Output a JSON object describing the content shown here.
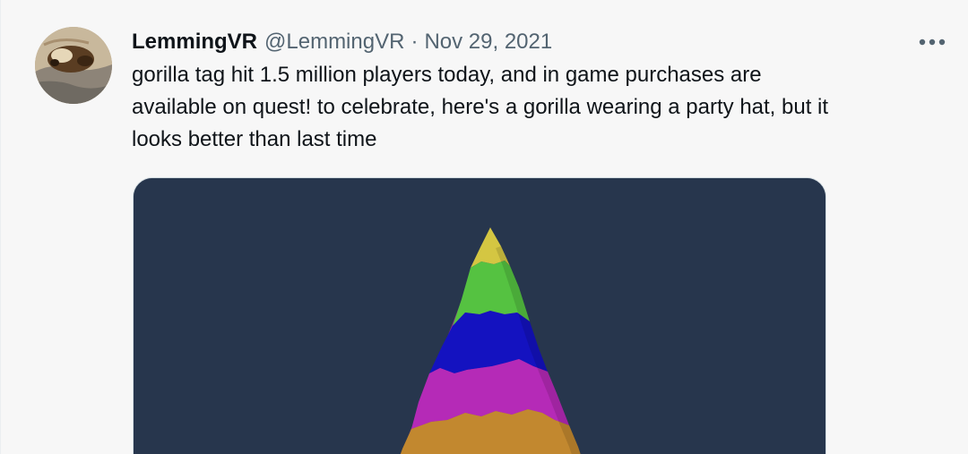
{
  "tweet": {
    "display_name": "LemmingVR",
    "handle": "@LemmingVR",
    "separator": "·",
    "date": "Nov 29, 2021",
    "more_icon": "more-horizontal-icon",
    "text": "gorilla tag hit 1.5 million players today, and in game purchases are\navailable on quest! to celebrate, here's a gorilla wearing a party hat, but it\nlooks better than last time"
  },
  "media": {
    "background_color": "#27364d",
    "hat_stripe_colors": [
      "#d4c642",
      "#55c241",
      "#1412c0",
      "#b52ab7",
      "#c2882f"
    ]
  }
}
